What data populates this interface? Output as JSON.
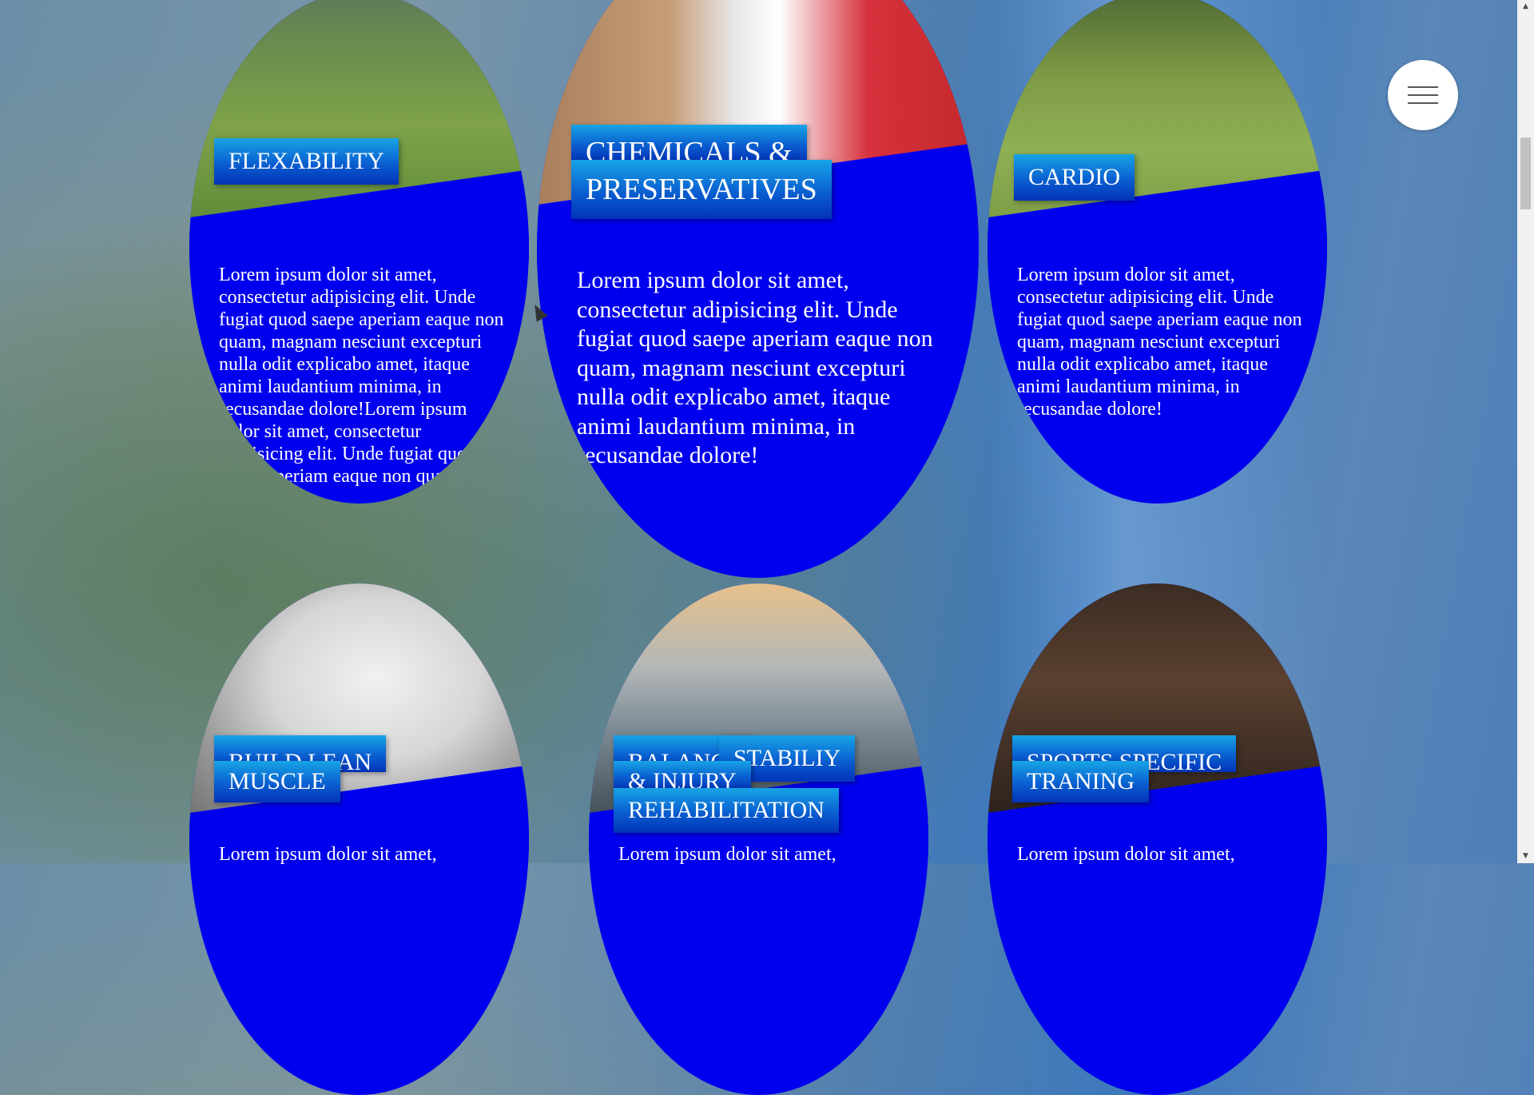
{
  "menu": {
    "icon": "hamburger-icon"
  },
  "cards": [
    {
      "title_line1": "FLEXABILITY",
      "text": "Lorem ipsum dolor sit amet, consectetur adipisicing elit. Unde fugiat quod saepe aperiam eaque non quam, magnam nesciunt excepturi nulla odit explicabo amet, itaque animi laudantium minima, in recusandae dolore!Lorem ipsum dolor sit amet, consectetur adipisicing elit. Unde fugiat quod saepe aperiam eaque non quam, magnam"
    },
    {
      "title_line1": "CHEMICALS &",
      "title_line2": "PRESERVATIVES",
      "text": "Lorem ipsum dolor sit amet, consectetur adipisicing elit. Unde fugiat quod saepe aperiam eaque non quam, magnam nesciunt excepturi nulla odit explicabo amet, itaque animi laudantium minima, in recusandae dolore!"
    },
    {
      "title_line1": "CARDIO",
      "text": "Lorem ipsum dolor sit amet, consectetur adipisicing elit. Unde fugiat quod saepe aperiam eaque non quam, magnam nesciunt excepturi nulla odit explicabo amet, itaque animi laudantium minima, in recusandae dolore!"
    },
    {
      "title_line1": "BUILD LEAN",
      "title_line2": "MUSCLE",
      "text": "Lorem ipsum dolor sit amet,"
    },
    {
      "title_line1": "BALANCE",
      "title_line1b": "STABILIY",
      "title_line2": "& INJURY",
      "title_line3": "REHABILITATION",
      "text": "Lorem ipsum dolor sit amet,"
    },
    {
      "title_line1": "SPORTS SPECIFIC",
      "title_line2": "TRANING",
      "text": "Lorem ipsum dolor sit amet,"
    }
  ],
  "colors": {
    "card_blue": "#0000ee",
    "tag_gradient_top": "#17a4e6",
    "tag_gradient_bottom": "#0233b8"
  },
  "icons": {
    "scroll_up": "▲",
    "scroll_down": "▼"
  }
}
